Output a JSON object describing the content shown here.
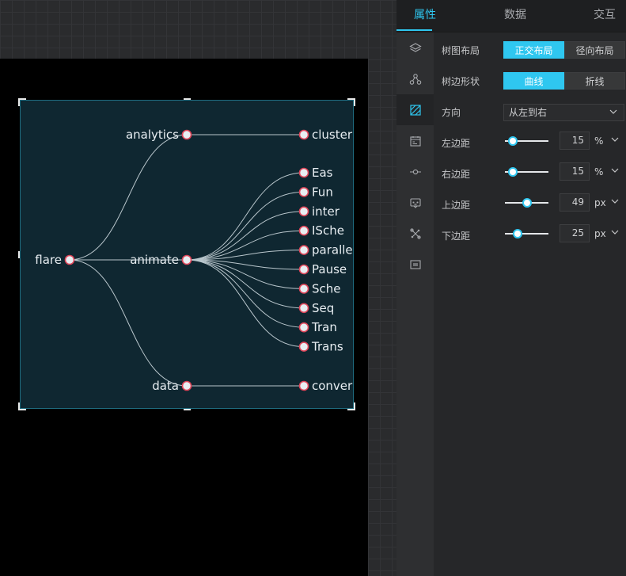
{
  "panel": {
    "tabs": [
      "属性",
      "数据",
      "交互"
    ],
    "icons": [
      "layers-icon",
      "nodes-icon",
      "pattern-icon",
      "calendar-icon",
      "connector-icon",
      "chat-icon",
      "tools-icon",
      "code-icon"
    ],
    "layout": {
      "label": "树图布局",
      "options": [
        "正交布局",
        "径向布局"
      ],
      "selected": "正交布局"
    },
    "edge": {
      "label": "树边形状",
      "options": [
        "曲线",
        "折线"
      ],
      "selected": "曲线"
    },
    "direction": {
      "label": "方向",
      "value": "从左到右"
    },
    "margins": [
      {
        "label": "左边距",
        "value": "15",
        "unit": "%"
      },
      {
        "label": "右边距",
        "value": "15",
        "unit": "%"
      },
      {
        "label": "上边距",
        "value": "49",
        "unit": "px"
      },
      {
        "label": "下边距",
        "value": "25",
        "unit": "px"
      }
    ],
    "accent": "#2fc7f0"
  },
  "tree": {
    "root": "flare",
    "children": [
      {
        "name": "analytics",
        "children": [
          "cluster"
        ]
      },
      {
        "name": "animate",
        "children": [
          "Eas",
          "Fun",
          "inter",
          "ISche",
          "parallel",
          "Pause",
          "Sche",
          "Seq",
          "Tran",
          "Trans"
        ]
      },
      {
        "name": "data",
        "children": [
          "conver"
        ]
      }
    ],
    "colors": {
      "background": "#0f2731",
      "node_stroke": "#e0465a",
      "node_fill": "#e8eef2",
      "edge": "#b9c6cc"
    }
  }
}
